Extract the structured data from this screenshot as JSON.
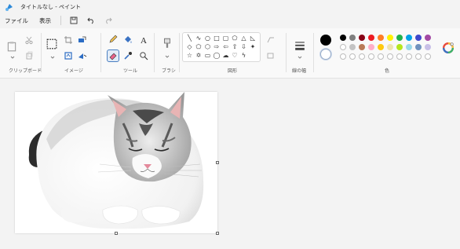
{
  "window": {
    "title": "タイトルなし - ペイント"
  },
  "menu": {
    "file": "ファイル",
    "view": "表示"
  },
  "groups": {
    "clipboard": "クリップボード",
    "image": "イメージ",
    "tools": "ツール",
    "brushes": "ブラシ",
    "shapes": "図形",
    "size": "線の幅",
    "colors": "色"
  },
  "colors": {
    "primary": "#000000",
    "secondary": "#ffffff",
    "palette_row1": [
      "#000000",
      "#7f7f7f",
      "#880015",
      "#ed1c24",
      "#ff7f27",
      "#fff200",
      "#22b14c",
      "#00a2e8",
      "#3f48cc",
      "#a349a4"
    ],
    "palette_row2": [
      "#ffffff",
      "#c3c3c3",
      "#b97a57",
      "#ffaec9",
      "#ffc90e",
      "#efe4b0",
      "#b5e61d",
      "#99d9ea",
      "#7092be",
      "#c8bfe7"
    ]
  },
  "canvas": {
    "content": "cat-photo"
  }
}
